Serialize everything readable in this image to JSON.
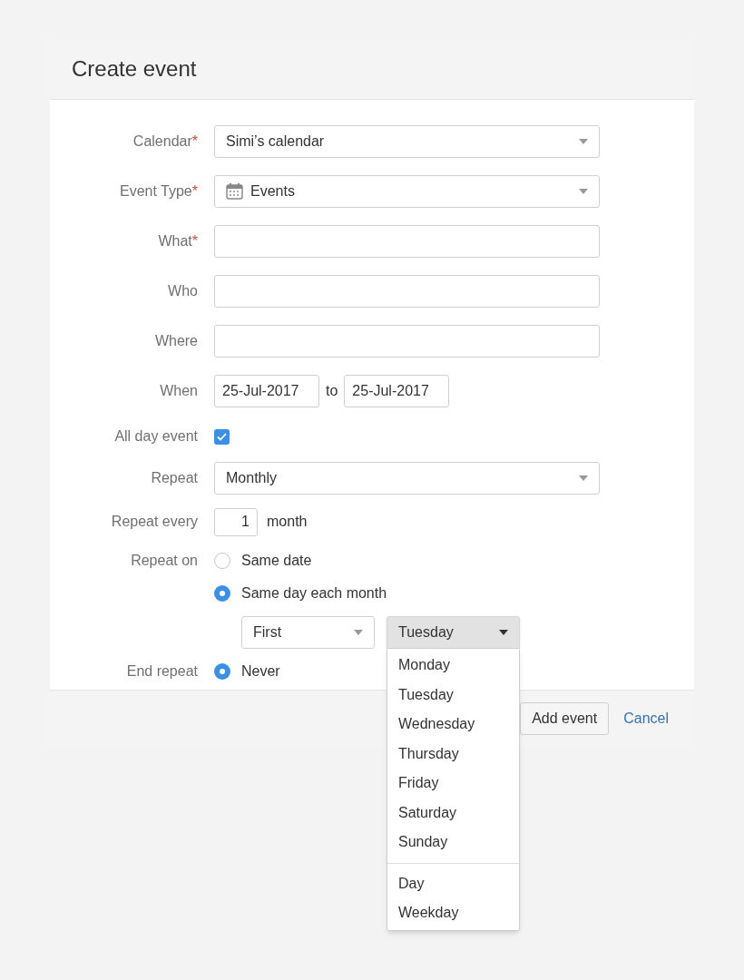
{
  "dialog": {
    "title": "Create event",
    "fields": [
      {
        "kind": "select",
        "label": "Calendar",
        "required_mark": "*",
        "value": "Simi’s calendar"
      },
      {
        "kind": "icon_select",
        "label": "Event Type",
        "required_mark": "*",
        "value": "Events"
      },
      {
        "kind": "text",
        "label": "What",
        "required_mark": "*"
      },
      {
        "kind": "text",
        "label": "Who"
      },
      {
        "kind": "text",
        "label": "Where"
      },
      {
        "kind": "date_range",
        "label": "When",
        "from": "25-Jul-2017",
        "connector": "to",
        "to": "25-Jul-2017"
      },
      {
        "kind": "checkbox",
        "label": "All day event",
        "checked": true
      },
      {
        "kind": "select",
        "label": "Repeat",
        "value": "Monthly"
      },
      {
        "kind": "number",
        "label": "Repeat every",
        "value": "1",
        "unit": "month"
      },
      {
        "kind": "radio_group",
        "label": "Repeat on",
        "options": [
          {
            "label": "Same date",
            "selected": false
          },
          {
            "label": "Same day each month",
            "selected": true
          }
        ],
        "sub_selects": [
          {
            "value": "First",
            "open": false
          },
          {
            "value": "Tuesday",
            "open": true,
            "menu_groups": [
              [
                "Monday",
                "Tuesday",
                "Wednesday",
                "Thursday",
                "Friday",
                "Saturday",
                "Sunday"
              ],
              [
                "Day",
                "Weekday"
              ]
            ]
          }
        ]
      },
      {
        "kind": "radio_group",
        "label": "End repeat",
        "options": [
          {
            "label": "Never",
            "selected": true
          }
        ]
      }
    ],
    "buttons": [
      {
        "kind": "button",
        "label": "Add event"
      },
      {
        "kind": "link",
        "label": "Cancel"
      }
    ]
  }
}
